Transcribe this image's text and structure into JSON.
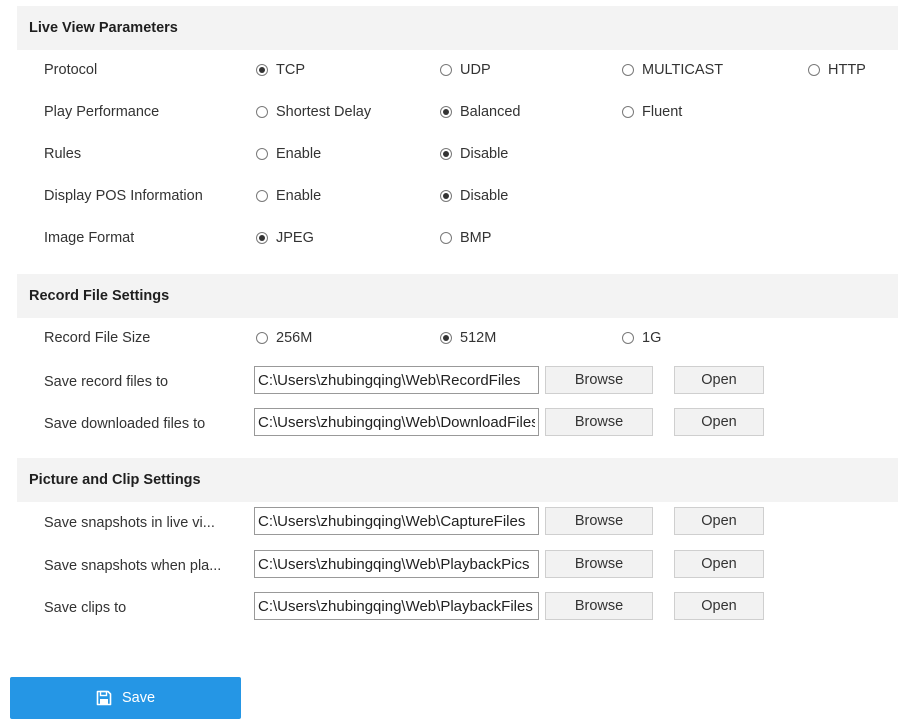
{
  "live_view": {
    "title": "Live View Parameters",
    "protocol": {
      "label": "Protocol",
      "options": [
        "TCP",
        "UDP",
        "MULTICAST",
        "HTTP"
      ],
      "selected": "TCP"
    },
    "play_performance": {
      "label": "Play Performance",
      "options": [
        "Shortest Delay",
        "Balanced",
        "Fluent"
      ],
      "selected": "Balanced"
    },
    "rules": {
      "label": "Rules",
      "options": [
        "Enable",
        "Disable"
      ],
      "selected": "Disable"
    },
    "display_pos": {
      "label": "Display POS Information",
      "options": [
        "Enable",
        "Disable"
      ],
      "selected": "Disable"
    },
    "image_format": {
      "label": "Image Format",
      "options": [
        "JPEG",
        "BMP"
      ],
      "selected": "JPEG"
    }
  },
  "record_file": {
    "title": "Record File Settings",
    "file_size": {
      "label": "Record File Size",
      "options": [
        "256M",
        "512M",
        "1G"
      ],
      "selected": "512M"
    },
    "save_record": {
      "label": "Save record files to",
      "value": "C:\\Users\\zhubingqing\\Web\\RecordFiles"
    },
    "save_downloaded": {
      "label": "Save downloaded files to",
      "value": "C:\\Users\\zhubingqing\\Web\\DownloadFiles"
    }
  },
  "picture_clip": {
    "title": "Picture and Clip Settings",
    "save_snapshots_live": {
      "label": "Save snapshots in live vi...",
      "value": "C:\\Users\\zhubingqing\\Web\\CaptureFiles"
    },
    "save_snapshots_play": {
      "label": "Save snapshots when pla...",
      "value": "C:\\Users\\zhubingqing\\Web\\PlaybackPics"
    },
    "save_clips": {
      "label": "Save clips to",
      "value": "C:\\Users\\zhubingqing\\Web\\PlaybackFiles"
    }
  },
  "buttons": {
    "browse": "Browse",
    "open": "Open",
    "save": "Save"
  },
  "colors": {
    "accent": "#2596e5",
    "section_bg": "#f3f3f3"
  },
  "icons": {
    "save": "floppy-disk-icon"
  }
}
